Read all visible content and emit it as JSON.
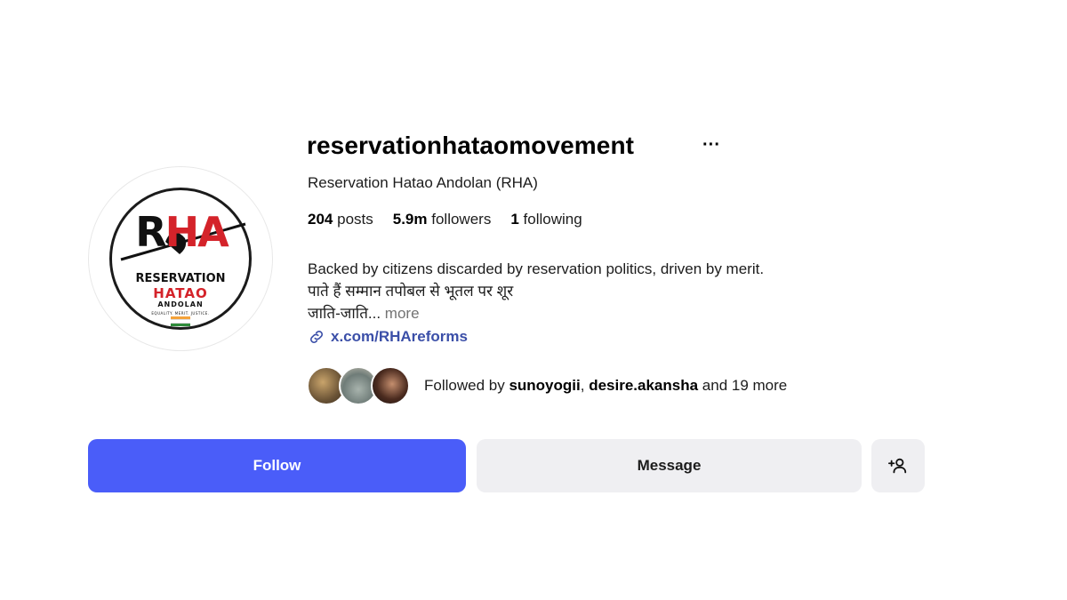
{
  "profile": {
    "username": "reservationhataomovement",
    "more_label": "···",
    "full_name": "Reservation Hatao Andolan (RHA)",
    "stats": {
      "posts_count": "204",
      "posts_label": "posts",
      "followers_count": "5.9m",
      "followers_label": "followers",
      "following_count": "1",
      "following_label": "following"
    },
    "bio": {
      "line1": "Backed by citizens discarded by reservation politics, driven by merit.",
      "line2": "पाते हैं सम्मान तपोबल से भूतल पर शूर",
      "line3": "जाति-जाति...",
      "more_label": "more"
    },
    "link": {
      "icon": "link-icon",
      "text": "x.com/RHAreforms"
    },
    "followed_by": {
      "prefix": "Followed by",
      "user1": "sunoyogii",
      "separator": ",",
      "user2": "desire.akansha",
      "suffix": "and 19 more"
    },
    "avatar_logo": {
      "letters_r": "R",
      "letters_ha": "HA",
      "line1": "RESERVATION",
      "line2": "HATAO",
      "line3": "ANDOLAN",
      "line4": "EQUALITY. MERIT. JUSTICE."
    }
  },
  "actions": {
    "follow_label": "Follow",
    "message_label": "Message",
    "add_user_icon": "person-add-icon"
  },
  "colors": {
    "follow_bg": "#4a5df9",
    "secondary_bg": "#efeff2",
    "link": "#3b4fa8",
    "logo_red": "#d4232a"
  }
}
